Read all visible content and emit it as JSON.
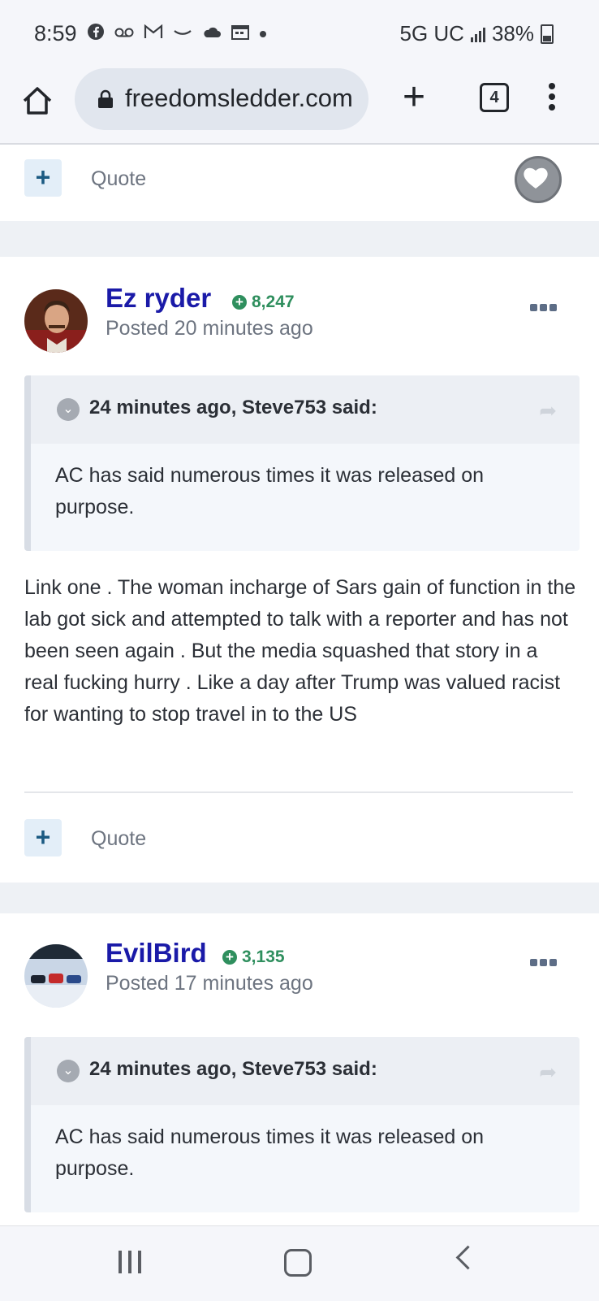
{
  "status_bar": {
    "time": "8:59",
    "notification_icons": [
      "facebook-icon",
      "voicemail-icon",
      "gmail-icon",
      "amazon-icon",
      "cloud-icon",
      "calendar-icon",
      "dot-icon"
    ],
    "network": "5G UC",
    "battery": "38%"
  },
  "browser": {
    "url": "freedomsledder.com",
    "tab_count": "4"
  },
  "top_card": {
    "quote_label": "Quote"
  },
  "posts": [
    {
      "author": "Ez ryder",
      "reputation": "8,247",
      "posted": "Posted 20 minutes ago",
      "quote": {
        "citation": "24 minutes ago, Steve753 said:",
        "text": "AC has said numerous times it was released on purpose."
      },
      "body": "Link one . The woman incharge of Sars gain of function in the lab got sick and attempted to talk with a reporter and has not been seen again . But the media squashed that story in a real fucking hurry . Like a day after Trump was valued racist for wanting to stop travel in to the US",
      "quote_label": "Quote"
    },
    {
      "author": "EvilBird",
      "reputation": "3,135",
      "posted": "Posted 17 minutes ago",
      "quote": {
        "citation": "24 minutes ago, Steve753 said:",
        "text": "AC has said numerous times it was released on purpose."
      }
    }
  ],
  "colors": {
    "author_link": "#1a1aa8",
    "reputation": "#2f8f5e",
    "page_bg": "#eef1f5",
    "quote_button_bg": "#e3eef8"
  }
}
